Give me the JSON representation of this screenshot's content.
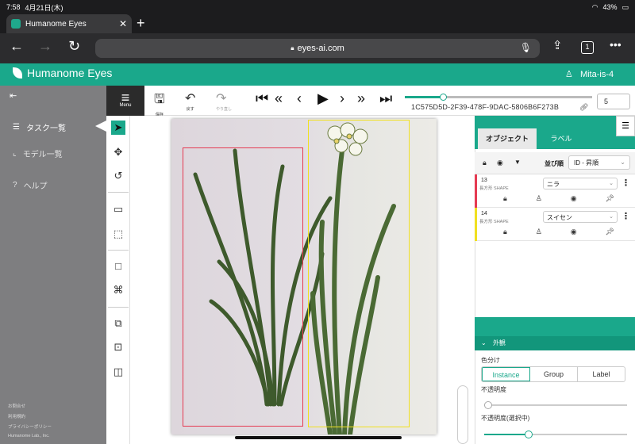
{
  "statusbar": {
    "time": "7:58",
    "date": "4月21日(木)",
    "battery": "43%"
  },
  "browser": {
    "tab_title": "Humanome Eyes",
    "url": "eyes-ai.com",
    "tab_count": "1"
  },
  "app": {
    "name": "Humanome Eyes",
    "user": "Mita-is-4"
  },
  "leftnav": {
    "items": [
      {
        "label": "タスク一覧",
        "icon": "list-icon"
      },
      {
        "label": "モデル一覧",
        "icon": "chart-icon"
      },
      {
        "label": "ヘルプ",
        "icon": "help-icon"
      }
    ],
    "footer": [
      "お問合せ",
      "利用規約",
      "プライバシーポリシー",
      "Humanome Lab., Inc."
    ]
  },
  "toolbar": {
    "menu_label": "Menu",
    "save_label": "保存",
    "undo_label": "戻す",
    "redo_label": "やり直し",
    "task_hash": "1C575D5D-2F39-478F-9DAC-5806B6F273B",
    "frame_value": "5",
    "slider_fraction": 0.2
  },
  "panel": {
    "tab_objects": "オブジェクト",
    "tab_labels": "ラベル",
    "sort_label": "並び順",
    "sort_value": "ID - 昇順",
    "objects": [
      {
        "id": "13",
        "type": "長方形 SHAPE",
        "label": "ニラ",
        "color": "#e53a52"
      },
      {
        "id": "14",
        "type": "長方形 SHAPE",
        "label": "スイセン",
        "color": "#f0e020"
      }
    ],
    "section_title": "外観",
    "color_by_label": "色分け",
    "color_by_options": [
      "Instance",
      "Group",
      "Label"
    ],
    "color_by_selected": "Instance",
    "opacity_label": "不透明度",
    "opacity_value": 0.0,
    "selected_opacity_label": "不透明度(選択中)",
    "selected_opacity_value": 0.3
  },
  "colors": {
    "brand": "#1aa88b",
    "box_red": "#e53a52",
    "box_yellow": "#f0e020"
  }
}
